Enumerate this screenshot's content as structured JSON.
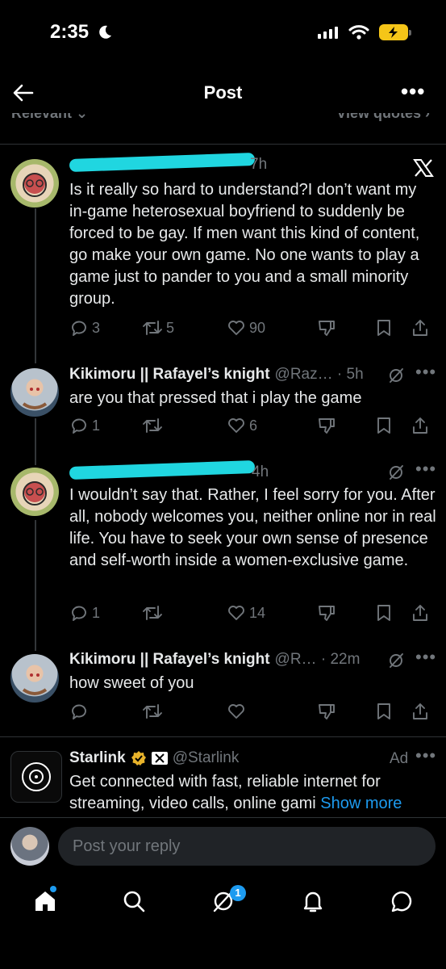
{
  "status_bar": {
    "time": "2:35"
  },
  "header": {
    "title": "Post",
    "sort_label": "Relevant ⌄",
    "quotes_label": "View quotes ›"
  },
  "tweets": [
    {
      "name_visible": "",
      "time": "7h",
      "text": "Is it really so hard to understand?I don’t want my in-game heterosexual boyfriend to suddenly be forced to be gay. If men want this kind of content, go make your own game. No one wants to play a game just to pander to you and a small minority group.",
      "replies": "3",
      "reposts": "5",
      "likes": "90"
    },
    {
      "name": "Kikimoru || Rafayel’s knight",
      "handle": "@Raz… · 5h",
      "text": "are you that pressed that i play the game",
      "replies": "1",
      "reposts": "",
      "likes": "6"
    },
    {
      "time": "4h",
      "text": "I wouldn’t say that. Rather, I feel sorry for you. After all, nobody welcomes you, neither online nor in real life. You have to seek your own sense of presence and self-worth inside a women-exclusive game.",
      "replies": "1",
      "reposts": "",
      "likes": "14"
    },
    {
      "name": "Kikimoru || Rafayel’s knight",
      "handle": "@R… · 22m",
      "text": "how sweet of you",
      "replies": "",
      "reposts": "",
      "likes": ""
    }
  ],
  "ad": {
    "name": "Starlink",
    "handle": "@Starlink",
    "label": "Ad",
    "text": "Get connected with fast, reliable internet for streaming, video calls, online gami",
    "show_more": "Show more"
  },
  "reply_bar": {
    "placeholder": "Post your reply"
  },
  "bottom_nav": {
    "notification_count": "1"
  },
  "colors": {
    "accent": "#1d9bf0",
    "redaction": "#20d6e0",
    "muted": "#71767b",
    "background": "#000000"
  }
}
